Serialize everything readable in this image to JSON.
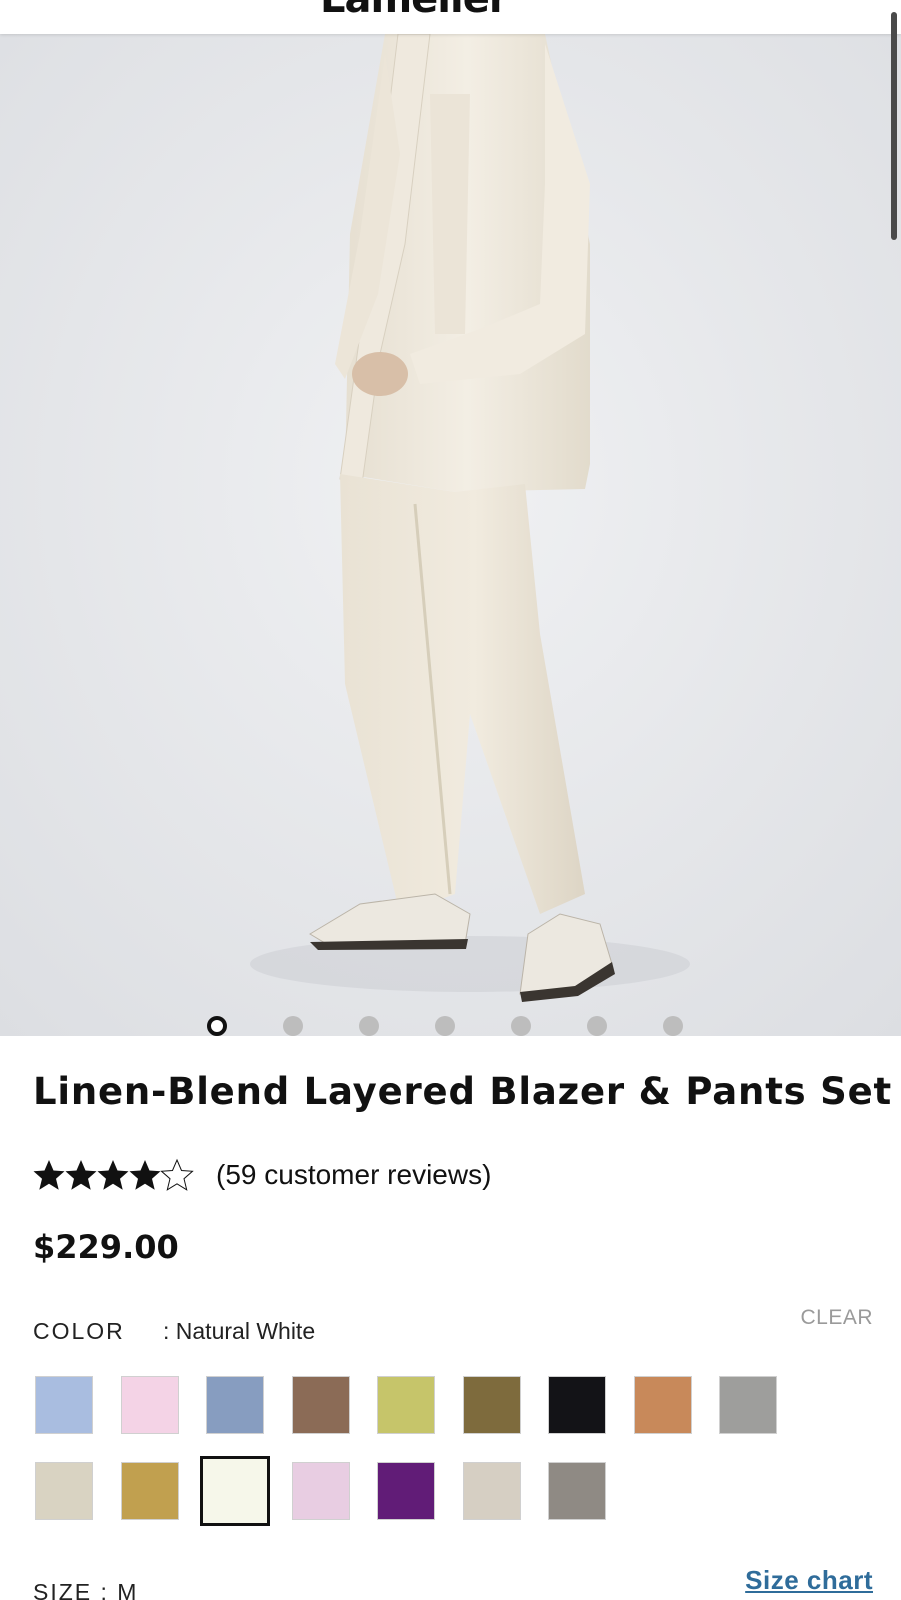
{
  "header": {
    "brand": "Lamelier",
    "menu_icon": "hamburger-menu-icon",
    "search_icon": "search-icon",
    "cart_icon": "cart-icon"
  },
  "hero": {
    "image": "model-wearing-linen-blazer-and-pants",
    "slide_count": 7,
    "active_slide": 1
  },
  "product": {
    "title": "Linen-Blend Layered Blazer & Pants Set",
    "rating": 4.5,
    "rating_max": 5,
    "reviews_text": "(59 customer reviews)",
    "price": "$229.00"
  },
  "color": {
    "label": "COLOR",
    "value": ": Natural White",
    "clear_label": "CLEAR",
    "swatches": [
      "#a9bde0",
      "#f4d3e6",
      "#879dc0",
      "#8b6b56",
      "#c6c56a",
      "#7e6b3d",
      "#131317",
      "#c8895a",
      "#9e9e9c",
      "#d9d3c2",
      "#c1a04f",
      "#f6f7ea",
      "#e8cde2",
      "#611c77",
      "#d6cfc3",
      "#8f8a84"
    ],
    "selected_index": 11
  },
  "size": {
    "label": "SIZE  : M",
    "chart_label": "Size chart"
  },
  "colors": {
    "star": "#111111",
    "link": "#2f6c9a",
    "muted": "#9a9a9a"
  }
}
